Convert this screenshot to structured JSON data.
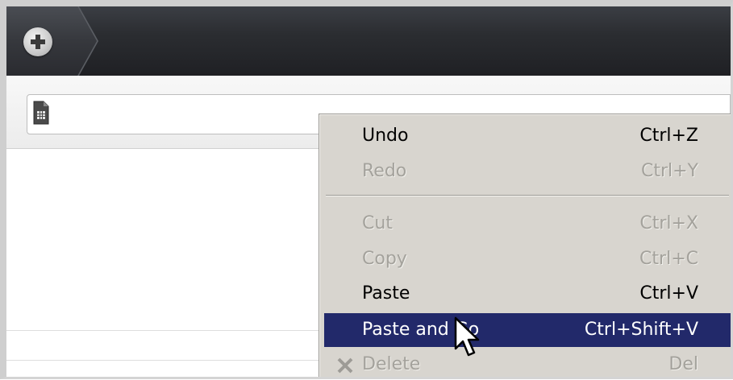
{
  "toolbar": {
    "new_tab_icon": "plus-circle-icon",
    "page_icon": "document-icon"
  },
  "context_menu": {
    "items": [
      {
        "label": "Undo",
        "shortcut": "Ctrl+Z",
        "enabled": true
      },
      {
        "label": "Redo",
        "shortcut": "Ctrl+Y",
        "enabled": false
      },
      {
        "label": "Cut",
        "shortcut": "Ctrl+X",
        "enabled": false
      },
      {
        "label": "Copy",
        "shortcut": "Ctrl+C",
        "enabled": false
      },
      {
        "label": "Paste",
        "shortcut": "Ctrl+V",
        "enabled": true
      },
      {
        "label": "Paste and Go",
        "shortcut": "Ctrl+Shift+V",
        "enabled": true,
        "highlighted": true
      },
      {
        "label": "Delete",
        "shortcut": "Del",
        "enabled": false,
        "icon": "delete-x-icon"
      }
    ]
  },
  "colors": {
    "highlight": "#22296a",
    "menu_bg": "#d8d5cf",
    "disabled_text": "#a4a29c",
    "tabstrip": "#2b2d31"
  }
}
